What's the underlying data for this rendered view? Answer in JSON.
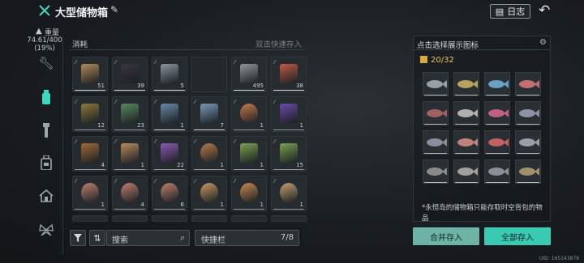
{
  "header": {
    "title": "大型储物箱",
    "edit_icon": "pencil-icon",
    "log_label": "日志",
    "back_icon": "return-arrow-icon"
  },
  "sidebar": {
    "weight_label": "重量",
    "weight_value": "74.61/400",
    "weight_percent": "(19%)",
    "tabs": [
      "wrench-icon",
      "bottle-icon",
      "flashlight-icon",
      "backpack-icon",
      "house-icon",
      "butterfly-icon"
    ]
  },
  "inventory": {
    "category": "消耗",
    "hint": "双击快速存入",
    "rows": [
      [
        {
          "name": "flour-bag",
          "count": "51",
          "color": "#b08a5a",
          "underline": "white"
        },
        {
          "name": "bread-loaf-dark",
          "count": "39",
          "color": "#3a3340",
          "underline": "white"
        },
        {
          "name": "wire-bundle",
          "count": "5",
          "color": "#8a96a0",
          "underline": "white"
        },
        {
          "name": "empty",
          "count": "",
          "color": "",
          "underline": ""
        },
        {
          "name": "bottle",
          "count": "495",
          "color": "#8f959a",
          "underline": "white"
        },
        {
          "name": "canned-food",
          "count": "38",
          "color": "#c05a44",
          "underline": "white"
        }
      ],
      [
        {
          "name": "glass-jar",
          "count": "12",
          "color": "#8a7a40",
          "underline": "grey"
        },
        {
          "name": "soda-bottle",
          "count": "23",
          "color": "#5a8a60",
          "underline": "grey"
        },
        {
          "name": "blue-can",
          "count": "1",
          "color": "#6a8aa8",
          "underline": "white"
        },
        {
          "name": "blue-can-2",
          "count": "7",
          "color": "#7a9ab8",
          "underline": "white"
        },
        {
          "name": "seafood-plate",
          "count": "1",
          "color": "#c87a50",
          "underline": "grey"
        },
        {
          "name": "cocktail",
          "count": "1",
          "color": "#6a4aa8",
          "underline": "grey"
        }
      ],
      [
        {
          "name": "bread",
          "count": "4",
          "color": "#a06a38",
          "underline": "grey"
        },
        {
          "name": "sandwich",
          "count": "1",
          "color": "#b88a5a",
          "underline": "grey"
        },
        {
          "name": "purple-bottle",
          "count": "22",
          "color": "#8a5ab0",
          "underline": "grey"
        },
        {
          "name": "pizza",
          "count": "1",
          "color": "#b87a4a",
          "underline": "grey"
        },
        {
          "name": "green-jar",
          "count": "1",
          "color": "#7aa050",
          "underline": "grey"
        },
        {
          "name": "green-jar-2",
          "count": "15",
          "color": "#7aa050",
          "underline": "grey"
        }
      ],
      [
        {
          "name": "octopus-dish",
          "count": "1",
          "color": "#c08070",
          "underline": "grey"
        },
        {
          "name": "octopus-dish-2",
          "count": "4",
          "color": "#c08070",
          "underline": "grey"
        },
        {
          "name": "octopus-dish-3",
          "count": "6",
          "color": "#c08070",
          "underline": "grey"
        },
        {
          "name": "noodle-bowl",
          "count": "1",
          "color": "#c89a60",
          "underline": "grey"
        },
        {
          "name": "noodle-bowl-2",
          "count": "1",
          "color": "#c88a50",
          "underline": "grey"
        },
        {
          "name": "noodle-bowl-3",
          "count": "1",
          "color": "#c8a070",
          "underline": "grey"
        }
      ]
    ],
    "filter_icon": "funnel-icon",
    "sort_icon": "sort-icon",
    "search_label": "搜索",
    "quick_label": "快捷栏",
    "quick_count": "7/8"
  },
  "display_panel": {
    "title": "点击选择展示图标",
    "gear_icon": "gear-icon",
    "count": "20/32",
    "fish": [
      {
        "name": "fish-1",
        "color": "#9aa0a8"
      },
      {
        "name": "fish-2",
        "color": "#b8a060"
      },
      {
        "name": "fish-3",
        "color": "#6aa0c0"
      },
      {
        "name": "fish-4",
        "color": "#c07070"
      },
      {
        "name": "fish-5",
        "color": "#a06060"
      },
      {
        "name": "fish-6",
        "color": "#b0b0b0"
      },
      {
        "name": "fish-7",
        "color": "#c06080"
      },
      {
        "name": "fish-8",
        "color": "#9090a8"
      },
      {
        "name": "fish-9",
        "color": "#8a8a9a"
      },
      {
        "name": "fish-10",
        "color": "#c08080"
      },
      {
        "name": "fish-11",
        "color": "#c06060"
      },
      {
        "name": "fish-12",
        "color": "#9a9aa8"
      },
      {
        "name": "fish-13",
        "color": "#8a8a8a"
      },
      {
        "name": "fish-14",
        "color": "#a0a0a0"
      },
      {
        "name": "fish-15",
        "color": "#8a9098"
      },
      {
        "name": "fish-16",
        "color": "#a09070"
      }
    ],
    "note": "*永恒岛的储物箱只能存取时空背包的物品"
  },
  "buttons": {
    "merge": "合并存入",
    "all": "全部存入"
  },
  "footer": {
    "uid": "UID: 165143879"
  }
}
